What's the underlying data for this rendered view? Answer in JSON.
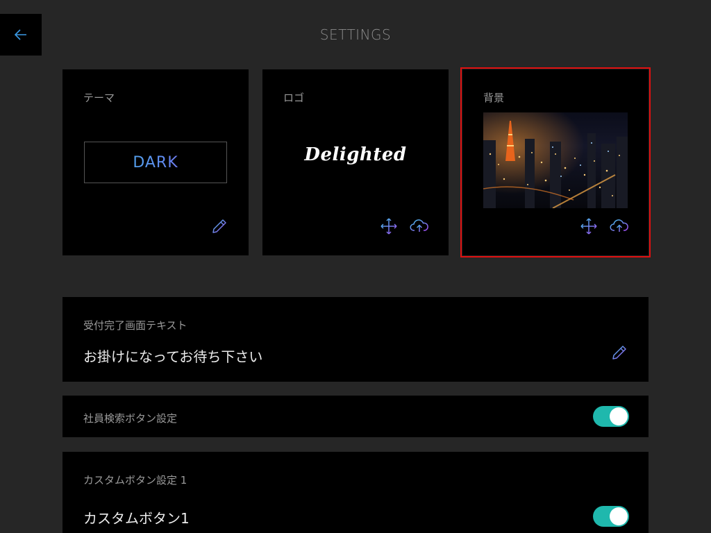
{
  "header": {
    "title": "SETTINGS",
    "back_icon": "arrow-left-icon"
  },
  "cards": {
    "theme": {
      "label": "テーマ",
      "value": "DARK",
      "edit_icon": "pencil-icon"
    },
    "logo": {
      "label": "ロゴ",
      "logo_text": "Delighted",
      "move_icon": "move-arrows-icon",
      "upload_icon": "cloud-upload-icon"
    },
    "background": {
      "label": "背景",
      "image": "night-city-tower-image",
      "move_icon": "move-arrows-icon",
      "upload_icon": "cloud-upload-icon",
      "selected": true
    }
  },
  "rows": {
    "completion_text": {
      "label": "受付完了画面テキスト",
      "value": "お掛けになってお待ち下さい",
      "edit_icon": "pencil-icon"
    },
    "employee_search": {
      "label": "社員検索ボタン設定",
      "enabled": true
    },
    "custom_button_1": {
      "label": "カスタムボタン設定 1",
      "value": "カスタムボタン1",
      "enabled": true
    }
  },
  "colors": {
    "accent_toggle": "#1fb8ad",
    "selection_outline": "#e01010",
    "icon_gradient_start": "#3fc0e6",
    "icon_gradient_end": "#a04bf0"
  }
}
